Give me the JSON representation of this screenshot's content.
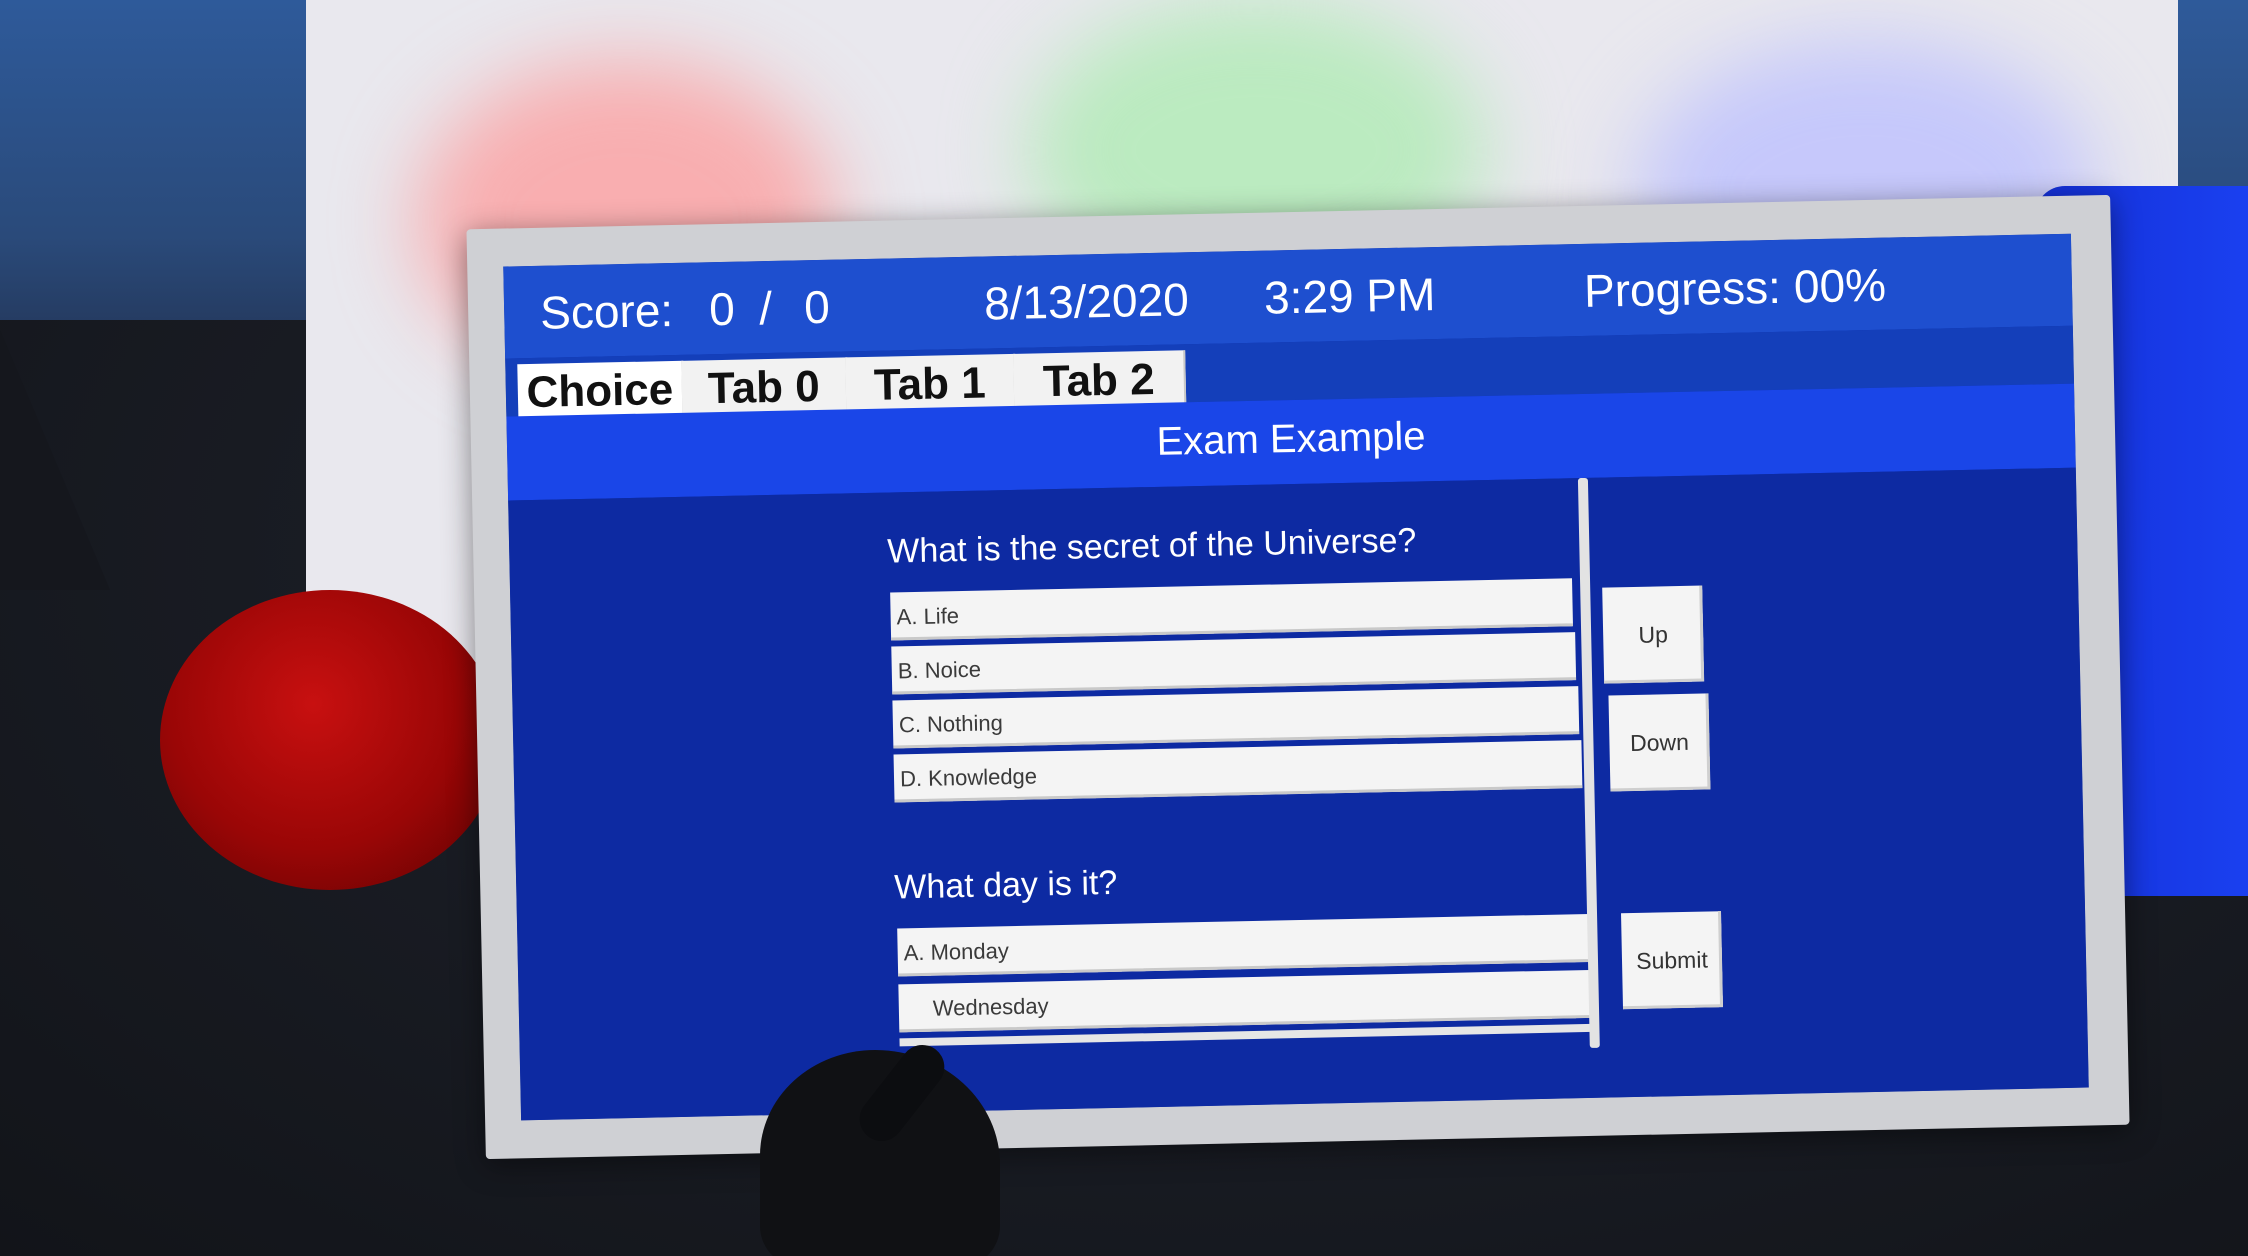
{
  "header": {
    "score_label": "Score:",
    "score_current": "0",
    "score_separator": "/",
    "score_total": "0",
    "date": "8/13/2020",
    "time": "3:29 PM",
    "progress_label": "Progress:",
    "progress_value": "00%"
  },
  "tabs": [
    {
      "label": "Choice",
      "active": true
    },
    {
      "label": "Tab 0",
      "active": false
    },
    {
      "label": "Tab 1",
      "active": false
    },
    {
      "label": "Tab 2",
      "active": false
    }
  ],
  "title": "Exam Example",
  "questions": [
    {
      "text": "What is the secret of the Universe?",
      "answers": [
        "A. Life",
        "B. Noice",
        "C. Nothing",
        "D. Knowledge"
      ]
    },
    {
      "text": "What day is it?",
      "answers": [
        "A. Monday",
        "Wednesday"
      ]
    }
  ],
  "buttons": {
    "up": "Up",
    "down": "Down",
    "submit": "Submit"
  },
  "colors": {
    "panel_blue": "#0f2ea8",
    "header_blue": "#1e4fcf",
    "title_blue": "#1a46e8",
    "button_bg": "#f4f4f4"
  }
}
